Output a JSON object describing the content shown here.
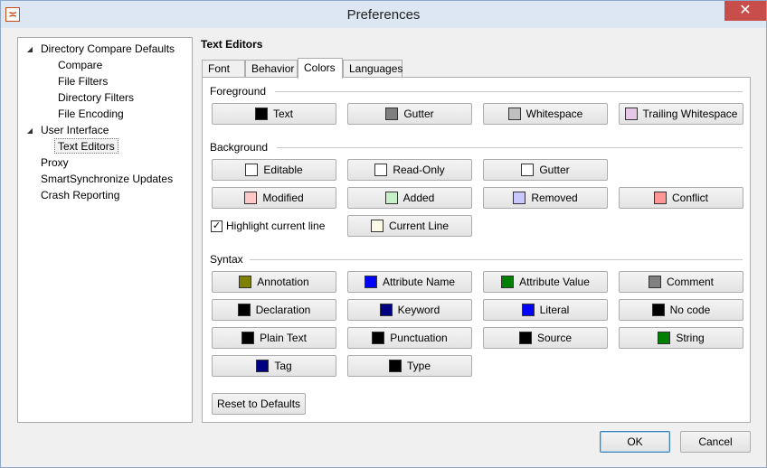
{
  "window": {
    "title": "Preferences",
    "close_glyph": "✕",
    "app_glyph": "≍"
  },
  "tree": {
    "items": [
      {
        "label": "Directory Compare Defaults",
        "level": 0,
        "expanded": true
      },
      {
        "label": "Compare",
        "level": 1
      },
      {
        "label": "File Filters",
        "level": 1
      },
      {
        "label": "Directory Filters",
        "level": 1
      },
      {
        "label": "File Encoding",
        "level": 1
      },
      {
        "label": "User Interface",
        "level": 0,
        "expanded": true
      },
      {
        "label": "Text Editors",
        "level": 1,
        "selected": true
      },
      {
        "label": "Proxy",
        "level": 0
      },
      {
        "label": "SmartSynchronize Updates",
        "level": 0
      },
      {
        "label": "Crash Reporting",
        "level": 0
      }
    ]
  },
  "section_title": "Text Editors",
  "tabs": [
    {
      "label": "Font"
    },
    {
      "label": "Behavior"
    },
    {
      "label": "Colors",
      "active": true
    },
    {
      "label": "Languages"
    }
  ],
  "groups": {
    "foreground": {
      "label": "Foreground",
      "buttons": [
        {
          "label": "Text",
          "color": "#000000"
        },
        {
          "label": "Gutter",
          "color": "#7f7f7f"
        },
        {
          "label": "Whitespace",
          "color": "#c0c0c0"
        },
        {
          "label": "Trailing Whitespace",
          "color": "#e6c8e6"
        }
      ]
    },
    "background": {
      "label": "Background",
      "buttons": [
        {
          "label": "Editable",
          "color": "#ffffff"
        },
        {
          "label": "Read-Only",
          "color": "#ffffff"
        },
        {
          "label": "Gutter",
          "color": "#ffffff"
        },
        {
          "label": "Modified",
          "color": "#ffc8c8"
        },
        {
          "label": "Added",
          "color": "#c8f0c8"
        },
        {
          "label": "Removed",
          "color": "#c8c8ff"
        },
        {
          "label": "Conflict",
          "color": "#ff9696"
        },
        {
          "label": "Current Line",
          "color": "#fafae6"
        }
      ],
      "highlight_label": "Highlight current line",
      "highlight_checked": "✓"
    },
    "syntax": {
      "label": "Syntax",
      "buttons": [
        {
          "label": "Annotation",
          "color": "#808000"
        },
        {
          "label": "Attribute Name",
          "color": "#0000ff"
        },
        {
          "label": "Attribute Value",
          "color": "#008000"
        },
        {
          "label": "Comment",
          "color": "#808080"
        },
        {
          "label": "Declaration",
          "color": "#000000"
        },
        {
          "label": "Keyword",
          "color": "#000080"
        },
        {
          "label": "Literal",
          "color": "#0000ff"
        },
        {
          "label": "No code",
          "color": "#000000"
        },
        {
          "label": "Plain Text",
          "color": "#000000"
        },
        {
          "label": "Punctuation",
          "color": "#000000"
        },
        {
          "label": "Source",
          "color": "#000000"
        },
        {
          "label": "String",
          "color": "#008000"
        },
        {
          "label": "Tag",
          "color": "#000080"
        },
        {
          "label": "Type",
          "color": "#000000"
        }
      ]
    }
  },
  "reset_label": "Reset to Defaults",
  "dialog": {
    "ok_label": "OK",
    "cancel_label": "Cancel"
  }
}
